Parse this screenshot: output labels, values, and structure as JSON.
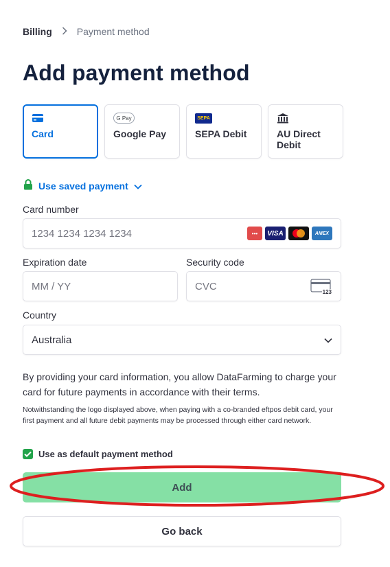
{
  "breadcrumb": {
    "parent": "Billing",
    "current": "Payment method"
  },
  "page_title": "Add payment method",
  "methods": [
    {
      "label": "Card",
      "icon": "card-icon",
      "active": true
    },
    {
      "label": "Google Pay",
      "icon": "google-pay-icon",
      "icon_text": "G Pay",
      "active": false
    },
    {
      "label": "SEPA Debit",
      "icon": "sepa-icon",
      "icon_text": "SEPA",
      "active": false
    },
    {
      "label": "AU Direct Debit",
      "icon": "bank-icon",
      "active": false
    }
  ],
  "saved_payment": {
    "label": "Use saved payment"
  },
  "card_number": {
    "label": "Card number",
    "placeholder": "1234 1234 1234 1234"
  },
  "card_brands": [
    {
      "name": "unionpay",
      "text": "•••"
    },
    {
      "name": "visa",
      "text": "VISA"
    },
    {
      "name": "mastercard",
      "text": ""
    },
    {
      "name": "amex",
      "text": "AMEX"
    }
  ],
  "expiration": {
    "label": "Expiration date",
    "placeholder": "MM / YY"
  },
  "security": {
    "label": "Security code",
    "placeholder": "CVC",
    "icon_text": "123"
  },
  "country": {
    "label": "Country",
    "value": "Australia"
  },
  "consent_text": "By providing your card information, you allow DataFarming to charge your card for future payments in accordance with their terms.",
  "notice_text": "Notwithstanding the logo displayed above, when paying with a co-branded eftpos debit card, your first payment and all future debit payments may be processed through either card network.",
  "default_method": {
    "label": "Use as default payment method",
    "checked": true
  },
  "buttons": {
    "add": "Add",
    "back": "Go back"
  },
  "colors": {
    "accent": "#0570de",
    "add_button": "#85e0a5",
    "checkbox": "#22a34a",
    "highlight": "#dd1f1f"
  }
}
